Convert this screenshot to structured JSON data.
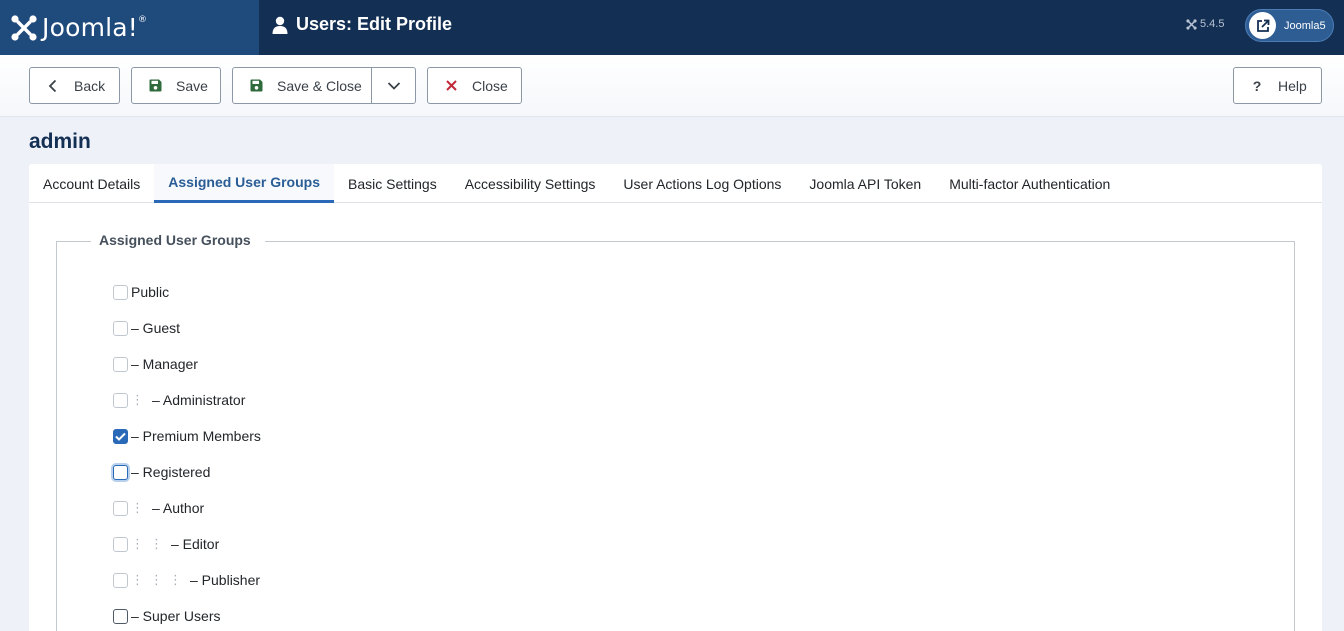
{
  "header": {
    "logo_text": "Joomla!",
    "page_title": "Users: Edit Profile",
    "version": "5.4.5",
    "site_label": "Joomla5"
  },
  "toolbar": {
    "back": "Back",
    "save": "Save",
    "save_close": "Save & Close",
    "close": "Close",
    "help": "Help"
  },
  "record": {
    "title": "admin"
  },
  "tabs": [
    {
      "label": "Account Details"
    },
    {
      "label": "Assigned User Groups"
    },
    {
      "label": "Basic Settings"
    },
    {
      "label": "Accessibility Settings"
    },
    {
      "label": "User Actions Log Options"
    },
    {
      "label": "Joomla API Token"
    },
    {
      "label": "Multi-factor Authentication"
    }
  ],
  "active_tab": "Assigned User Groups",
  "fieldset": {
    "legend": "Assigned User Groups",
    "groups": [
      {
        "label": "Public",
        "checked": false
      },
      {
        "label": "– Guest",
        "checked": false
      },
      {
        "label": "– Manager",
        "checked": false
      },
      {
        "label": "– Administrator",
        "checked": false
      },
      {
        "label": "– Premium Members",
        "checked": true
      },
      {
        "label": "– Registered",
        "checked": false
      },
      {
        "label": "– Author",
        "checked": false
      },
      {
        "label": "– Editor",
        "checked": false
      },
      {
        "label": "– Publisher",
        "checked": false
      },
      {
        "label": "– Super Users",
        "checked": false
      }
    ]
  },
  "colors": {
    "header_bg": "#132f53",
    "logo_bg": "#1f4a7c",
    "accent": "#2a69b8",
    "save_icon": "#2f6b3c",
    "close_icon": "#c0283a"
  }
}
